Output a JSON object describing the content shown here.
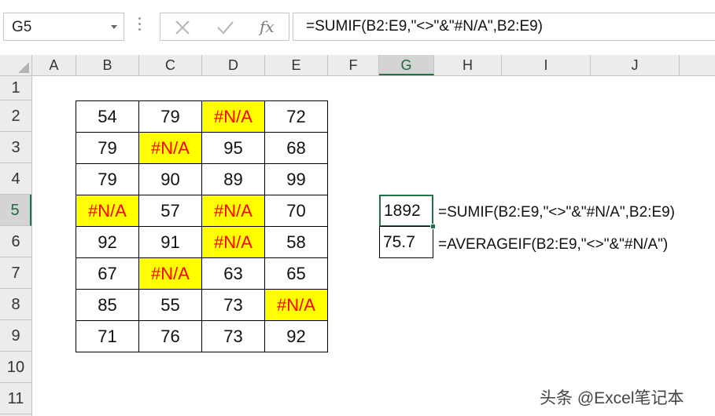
{
  "name_box": {
    "value": "G5"
  },
  "formula_bar": {
    "fx_label": "fx",
    "formula": "=SUMIF(B2:E9,\"<>\"&\"#N/A\",B2:E9)"
  },
  "columns": [
    "A",
    "B",
    "C",
    "D",
    "E",
    "F",
    "G",
    "H",
    "I",
    "J"
  ],
  "active_column": "G",
  "rows": [
    "1",
    "2",
    "3",
    "4",
    "5",
    "6",
    "7",
    "8",
    "9",
    "10",
    "11"
  ],
  "active_row": "5",
  "table": {
    "rows": [
      [
        "54",
        "79",
        "#N/A",
        "72"
      ],
      [
        "79",
        "#N/A",
        "95",
        "68"
      ],
      [
        "79",
        "90",
        "89",
        "99"
      ],
      [
        "#N/A",
        "57",
        "#N/A",
        "70"
      ],
      [
        "92",
        "91",
        "#N/A",
        "58"
      ],
      [
        "67",
        "#N/A",
        "63",
        "65"
      ],
      [
        "85",
        "55",
        "73",
        "#N/A"
      ],
      [
        "71",
        "76",
        "73",
        "92"
      ]
    ],
    "error_value": "#N/A",
    "error_fill": "#ffff00",
    "error_text_color": "#ff0000"
  },
  "results": {
    "sum": {
      "value": "1892",
      "formula_label": "=SUMIF(B2:E9,\"<>\"&\"#N/A\",B2:E9)"
    },
    "average": {
      "value": "75.7",
      "formula_label": "=AVERAGEIF(B2:E9,\"<>\"&\"#N/A\")"
    }
  },
  "watermark": "头条 @Excel笔记本",
  "colors": {
    "accent": "#217346",
    "header_bg": "#ececec",
    "grid": "#c4c4c4"
  }
}
